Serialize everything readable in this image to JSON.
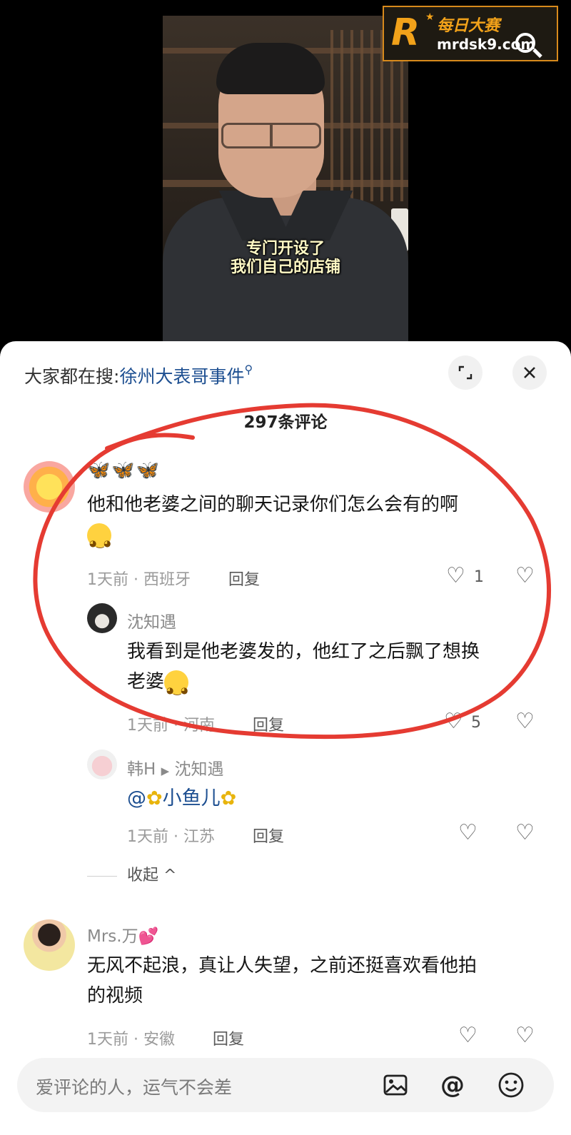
{
  "video": {
    "subtitle_line1": "专门开设了",
    "subtitle_line2": "我们自己的店铺"
  },
  "watermark": {
    "logo_letter": "R",
    "brand_cn": "每日大赛",
    "url": "mrdsk9.com"
  },
  "sheet": {
    "search_prefix": "大家都在搜:",
    "search_keyword": "徐州大表哥事件",
    "comment_count": "297条评论",
    "expand_icon": "expand-icon",
    "close_icon": "close-icon"
  },
  "comments": [
    {
      "name_emoji": "🦋🦋🦋",
      "text_line1": "他和他老婆之间的聊天记录你们怎么会有的啊",
      "meta": "1天前 · 西班牙",
      "reply": "回复",
      "likes": "1"
    },
    {
      "name": "沈知遇",
      "text_line1": "我看到是他老婆发的，他红了之后飘了想换",
      "text_line2": "老婆",
      "meta": "1天前 · 河南",
      "reply": "回复",
      "likes": "5"
    },
    {
      "name": "韩H",
      "reply_arrow": "▶",
      "reply_to": "沈知遇",
      "mention_at": "@",
      "mention_name": "小鱼儿",
      "meta": "1天前 · 江苏",
      "reply": "回复"
    },
    {
      "name": "Mrs.万",
      "name_badge": "💕",
      "text_line1": "无风不起浪，真让人失望，之前还挺喜欢看他拍",
      "text_line2": "的视频",
      "meta": "1天前 · 安徽",
      "reply": "回复"
    }
  ],
  "collapse_label": "收起 ^",
  "input": {
    "placeholder": "爱评论的人，运气不会差"
  },
  "colors": {
    "accent_blue": "#1d4f91",
    "scribble_red": "#e53b32",
    "watermark_orange": "#f2a21a"
  }
}
